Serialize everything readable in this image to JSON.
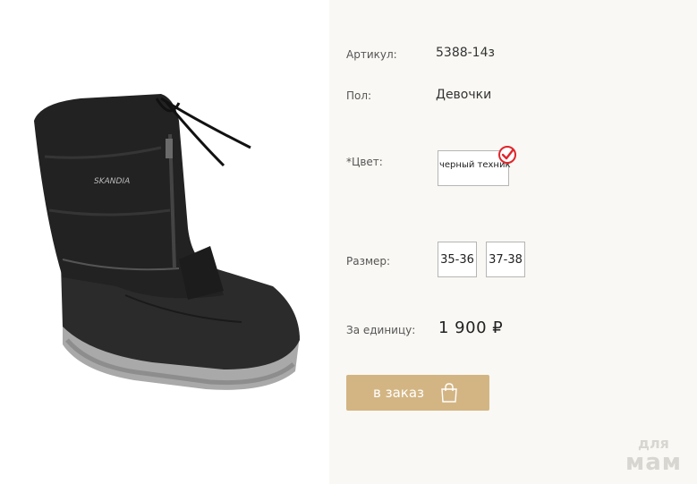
{
  "product": {
    "sku_label": "Артикул:",
    "sku_value": "5388-14з",
    "gender_label": "Пол:",
    "gender_value": "Девочки",
    "color_label": "*Цвет:",
    "color_option": "черный техник",
    "size_label": "Размер:",
    "sizes": [
      "35-36",
      "37-38"
    ],
    "price_label": "За единицу:",
    "price_value": "1 900 ₽",
    "order_button": "в заказ",
    "boot_brand": "SKANDIA"
  },
  "watermark": {
    "line1": "для",
    "line2": "мам"
  },
  "icons": {
    "selected": "check-circle-icon",
    "bag": "shopping-bag-icon"
  },
  "colors": {
    "accent": "#d3b583",
    "check": "#e0262b",
    "panel_bg": "#f9f8f4"
  }
}
